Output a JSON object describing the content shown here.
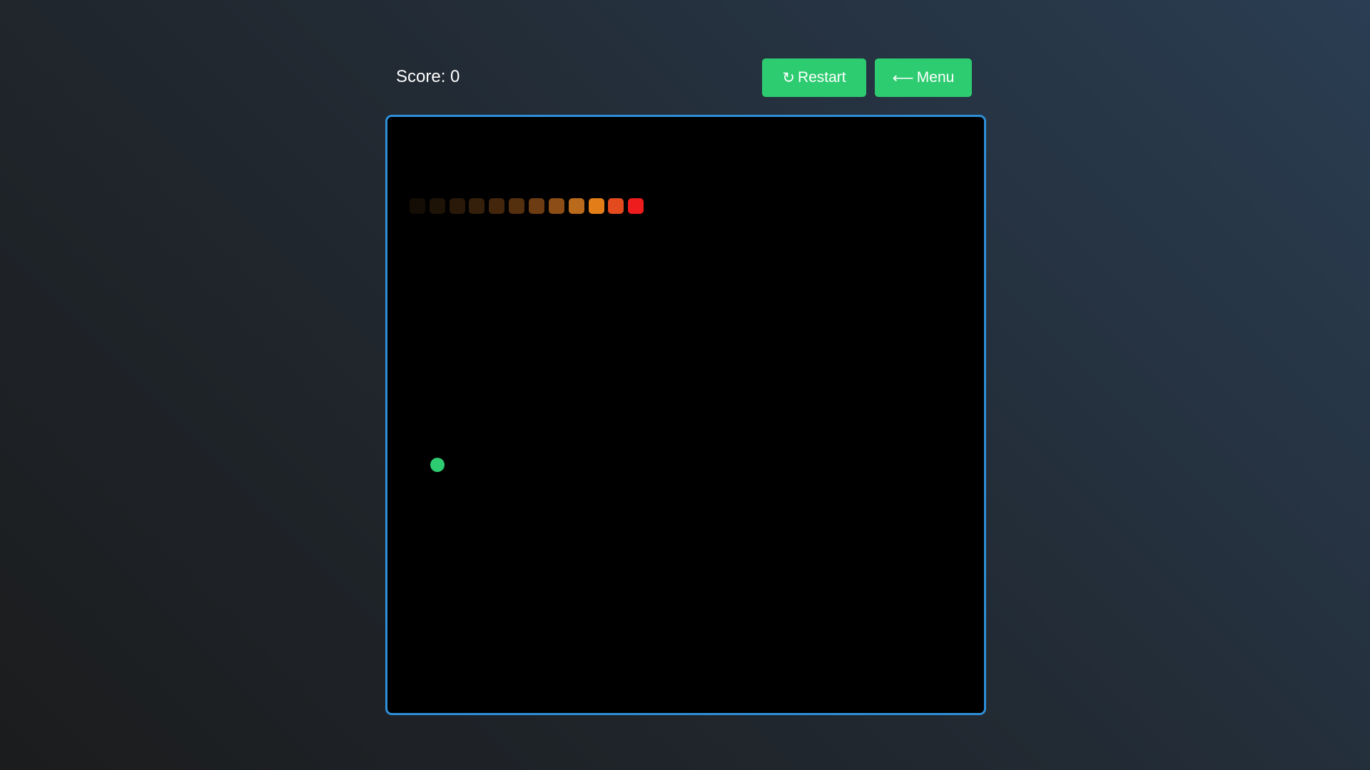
{
  "score": {
    "text": "Score: 0"
  },
  "buttons": {
    "restart": {
      "icon": "↻",
      "label": "Restart"
    },
    "menu": {
      "icon": "⟵",
      "label": "Menu"
    }
  },
  "game": {
    "grid_cols": 30,
    "grid_rows": 30,
    "snake": [
      {
        "col": 12,
        "row": 4,
        "color": "#ee1c1c"
      },
      {
        "col": 11,
        "row": 4,
        "color": "#e34b1e"
      },
      {
        "col": 10,
        "row": 4,
        "color": "#e27d18"
      },
      {
        "col": 9,
        "row": 4,
        "color": "#b96a1a"
      },
      {
        "col": 8,
        "row": 4,
        "color": "#8c4d17"
      },
      {
        "col": 7,
        "row": 4,
        "color": "#6e3c12"
      },
      {
        "col": 6,
        "row": 4,
        "color": "#54300f"
      },
      {
        "col": 5,
        "row": 4,
        "color": "#43260c"
      },
      {
        "col": 4,
        "row": 4,
        "color": "#35200b"
      },
      {
        "col": 3,
        "row": 4,
        "color": "#2a1909"
      },
      {
        "col": 2,
        "row": 4,
        "color": "#1e1307"
      },
      {
        "col": 1,
        "row": 4,
        "color": "#140d05"
      }
    ],
    "food": {
      "col": 2,
      "row": 17,
      "color": "#2ecc71"
    }
  },
  "colors": {
    "accent": "#2ecc71",
    "board_border": "#2f8fd8",
    "board_bg": "#000000"
  }
}
